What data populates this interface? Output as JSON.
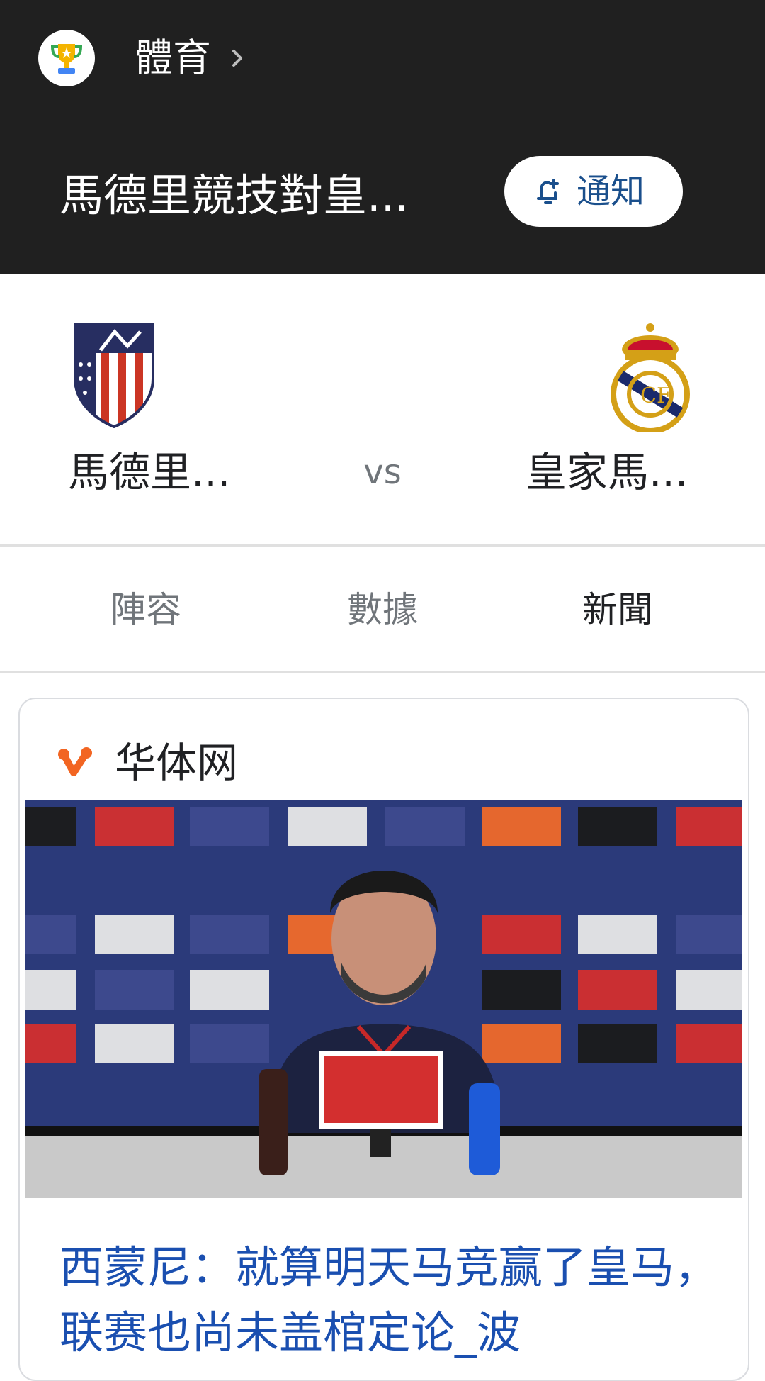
{
  "header": {
    "category": "體育",
    "category_icon": "trophy-icon",
    "chevron_icon": "chevron-right-icon"
  },
  "match": {
    "title": "馬德里競技對皇...",
    "notify_label": "通知",
    "notify_icon": "bell-add-icon"
  },
  "teams": {
    "home": {
      "name": "馬德里...",
      "logo": "atletico-madrid-crest"
    },
    "away": {
      "name": "皇家馬...",
      "logo": "real-madrid-crest"
    },
    "vs": "vs"
  },
  "tabs": [
    {
      "label": "陣容",
      "active": false
    },
    {
      "label": "數據",
      "active": false
    },
    {
      "label": "新聞",
      "active": true
    }
  ],
  "news": {
    "source": "华体网",
    "source_icon": "huatiwang-logo-icon",
    "image_alt": "press-conference-photo",
    "headline": "西蒙尼：就算明天马竞赢了皇马，联赛也尚未盖棺定论_波"
  },
  "colors": {
    "header_bg": "#202020",
    "link_blue": "#1a4fb0",
    "source_orange": "#f26522"
  }
}
